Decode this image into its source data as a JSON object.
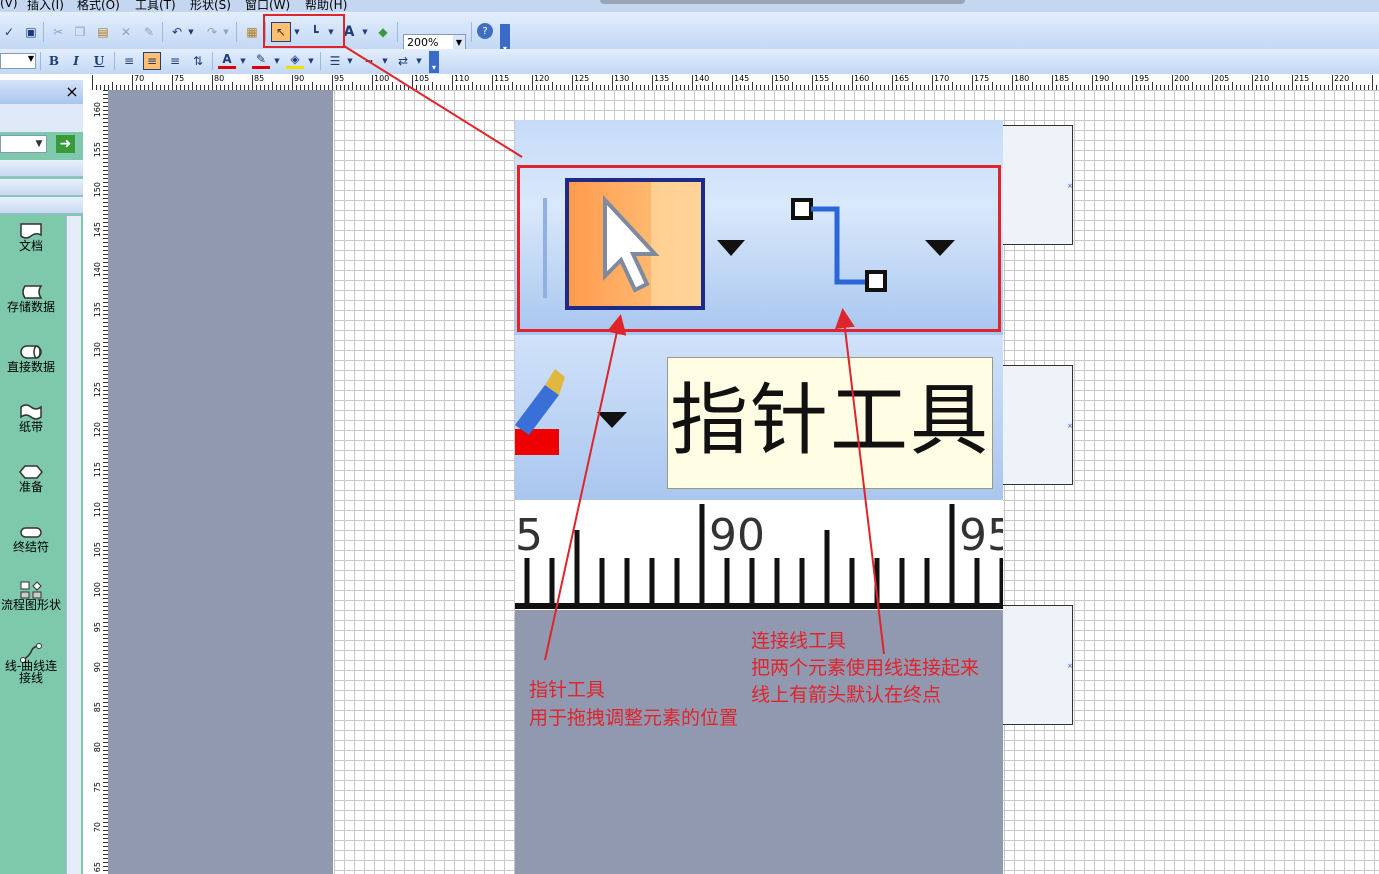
{
  "menu": {
    "items": [
      "(V)",
      "插入(I)",
      "格式(O)",
      "工具(T)",
      "形状(S)",
      "窗口(W)",
      "帮助(H)"
    ]
  },
  "toolbar": {
    "zoom_value": "200%",
    "font_bold": "B",
    "font_italic": "I",
    "font_underline": "U",
    "text_tool": "A"
  },
  "ruler": {
    "h_labels": [
      "70",
      "75",
      "80",
      "85",
      "90",
      "95",
      "100",
      "105",
      "110",
      "115",
      "120",
      "125",
      "130",
      "135",
      "140",
      "145",
      "150",
      "155",
      "160",
      "165",
      "170",
      "175",
      "180",
      "185",
      "190",
      "195",
      "200",
      "205",
      "210",
      "215",
      "220"
    ],
    "v_labels": [
      "160",
      "155",
      "150",
      "145",
      "140",
      "135",
      "130",
      "125",
      "120",
      "115",
      "110",
      "105",
      "100",
      "95",
      "90",
      "85",
      "80",
      "75",
      "70",
      "65"
    ]
  },
  "shapes_panel": {
    "close_label": "×",
    "go_label": "➜",
    "items": [
      {
        "label": "文档",
        "icon": "document-shape-icon"
      },
      {
        "label": "存储数据",
        "icon": "stored-data-shape-icon"
      },
      {
        "label": "直接数据",
        "icon": "direct-data-shape-icon"
      },
      {
        "label": "纸带",
        "icon": "paper-tape-shape-icon"
      },
      {
        "label": "准备",
        "icon": "preparation-shape-icon"
      },
      {
        "label": "终结符",
        "icon": "terminator-shape-icon"
      },
      {
        "label": "流程图形状",
        "icon": "flowchart-shapes-icon"
      },
      {
        "label": "线-曲线连",
        "label2": "接线",
        "icon": "curve-connector-icon"
      }
    ]
  },
  "inset": {
    "tooltip_text": "指针工具",
    "ruler_label_left": "5",
    "ruler_label_mid": "90",
    "ruler_label_right": "95"
  },
  "annotations": {
    "pointer_title": "指针工具",
    "pointer_desc": "用于拖拽调整元素的位置",
    "connector_title": "连接线工具",
    "connector_desc1": "把两个元素使用线连接起来",
    "connector_desc2": "线上有箭头默认在终点"
  },
  "colors": {
    "annotation_red": "#e0242b",
    "panel_green": "#7ec8ac",
    "toolbar_blue": "#c3d8f5",
    "pointer_orange": "#ffa24f"
  }
}
